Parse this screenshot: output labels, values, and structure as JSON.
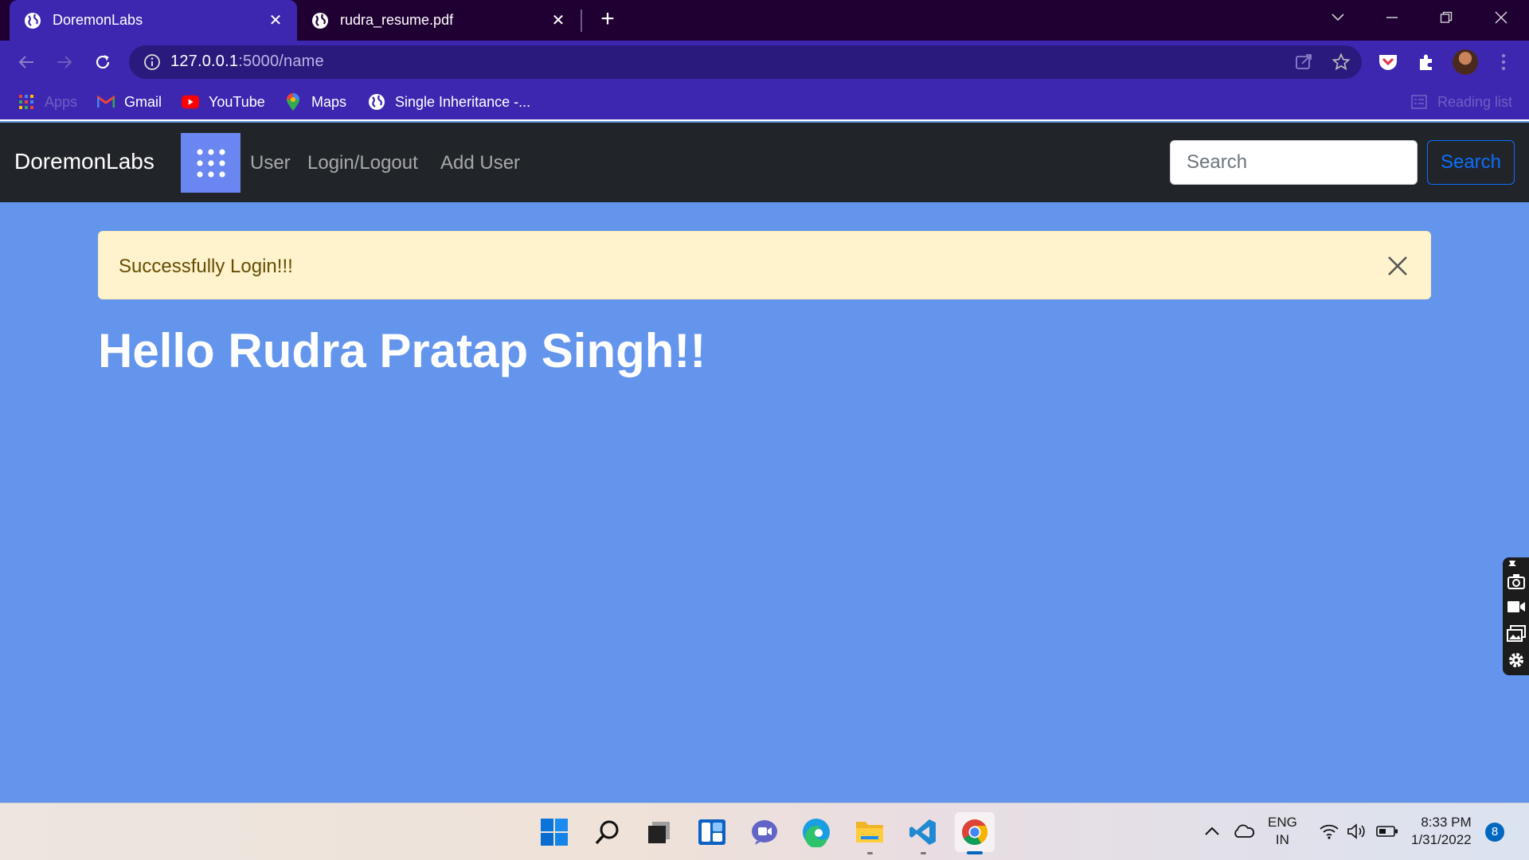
{
  "browser": {
    "tabs": [
      {
        "title": "DoremonLabs",
        "active": true
      },
      {
        "title": "rudra_resume.pdf",
        "active": false
      }
    ],
    "url_host": "127.0.0.1",
    "url_path": ":5000/name",
    "bookmarks": [
      {
        "label": "Apps",
        "icon": "apps-grid-icon"
      },
      {
        "label": "Gmail",
        "icon": "gmail-icon"
      },
      {
        "label": "YouTube",
        "icon": "youtube-icon"
      },
      {
        "label": "Maps",
        "icon": "maps-icon"
      },
      {
        "label": "Single Inheritance -...",
        "icon": "globe-icon"
      }
    ],
    "reading_list": "Reading list",
    "theme_color": "#3d27b0"
  },
  "navbar": {
    "brand": "DoremonLabs",
    "links": [
      "User",
      "Login/Logout",
      "Add User"
    ],
    "search_placeholder": "Search",
    "search_button": "Search"
  },
  "alert": {
    "message": "Successfully Login!!!"
  },
  "main": {
    "greeting": "Hello Rudra Pratap Singh!!",
    "background": "#6495ed"
  },
  "taskbar": {
    "apps": [
      "start-icon",
      "search-icon",
      "task-view-icon",
      "widgets-icon",
      "teams-chat-icon",
      "edge-icon",
      "file-explorer-icon",
      "vscode-icon",
      "chrome-icon"
    ],
    "language_line1": "ENG",
    "language_line2": "IN",
    "time": "8:33 PM",
    "date": "1/31/2022",
    "notification_count": "8"
  }
}
